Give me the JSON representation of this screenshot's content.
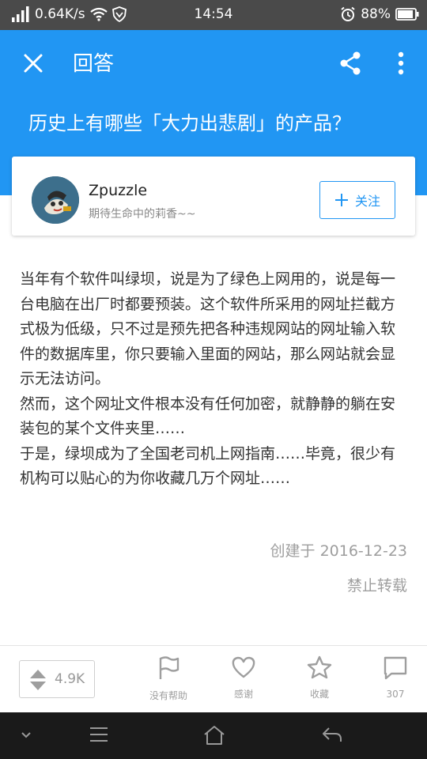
{
  "status_bar": {
    "network_speed": "0.64K/s",
    "time": "14:54",
    "battery": "88%"
  },
  "toolbar": {
    "title": "回答"
  },
  "question": {
    "title": "历史上有哪些「大力出悲剧」的产品？"
  },
  "author": {
    "name": "Zpuzzle",
    "bio": "期待生命中的莉香~~",
    "follow_label": "关注"
  },
  "answer": {
    "paragraphs": [
      "当年有个软件叫绿坝，说是为了绿色上网用的，说是每一台电脑在出厂时都要预装。这个软件所采用的网址拦截方式极为低级，只不过是预先把各种违规网站的网址输入软件的数据库里，你只要输入里面的网站，那么网站就会显示无法访问。",
      "然而，这个网址文件根本没有任何加密，就静静的躺在安装包的某个文件夹里……",
      "于是，绿坝成为了全国老司机上网指南……毕竟，很少有机构可以贴心的为你收藏几万个网址……"
    ],
    "created": "创建于 2016-12-23",
    "copyright": "禁止转载"
  },
  "actions": {
    "vote_count": "4.9K",
    "unhelpful_label": "没有帮助",
    "thanks_label": "感谢",
    "collect_label": "收藏",
    "comment_count": "307"
  },
  "colors": {
    "primary": "#2196f3",
    "status_bar": "#4a4a4a",
    "nav_bar": "#1a1a1a"
  }
}
